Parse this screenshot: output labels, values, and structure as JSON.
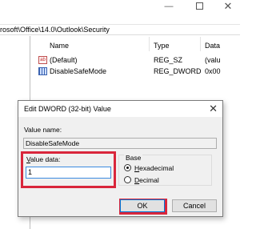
{
  "regedit": {
    "path": "rosoft\\Office\\14.0\\Outlook\\Security",
    "columns": [
      "Name",
      "Type",
      "Data"
    ],
    "rows": [
      {
        "name": "(Default)",
        "type": "REG_SZ",
        "data": "(valu",
        "icon": "string-value-icon"
      },
      {
        "name": "DisableSafeMode",
        "type": "REG_DWORD",
        "data": "0x00",
        "icon": "binary-value-icon"
      }
    ],
    "window_controls": {
      "minimize": "—",
      "close": "✕"
    }
  },
  "dialog": {
    "title": "Edit DWORD (32-bit) Value",
    "close_glyph": "✕",
    "value_name_label": "Value name:",
    "value_name": "DisableSafeMode",
    "value_data_label_first": "V",
    "value_data_label_rest": "alue data:",
    "value_data": "1",
    "base_label": "Base",
    "base_options": [
      {
        "first": "H",
        "rest": "exadecimal",
        "selected": true
      },
      {
        "first": "D",
        "rest": "ecimal",
        "selected": false
      }
    ],
    "ok_label": "OK",
    "cancel_label": "Cancel"
  },
  "colors": {
    "highlight": "#d9263b",
    "focus": "#0078d7"
  }
}
